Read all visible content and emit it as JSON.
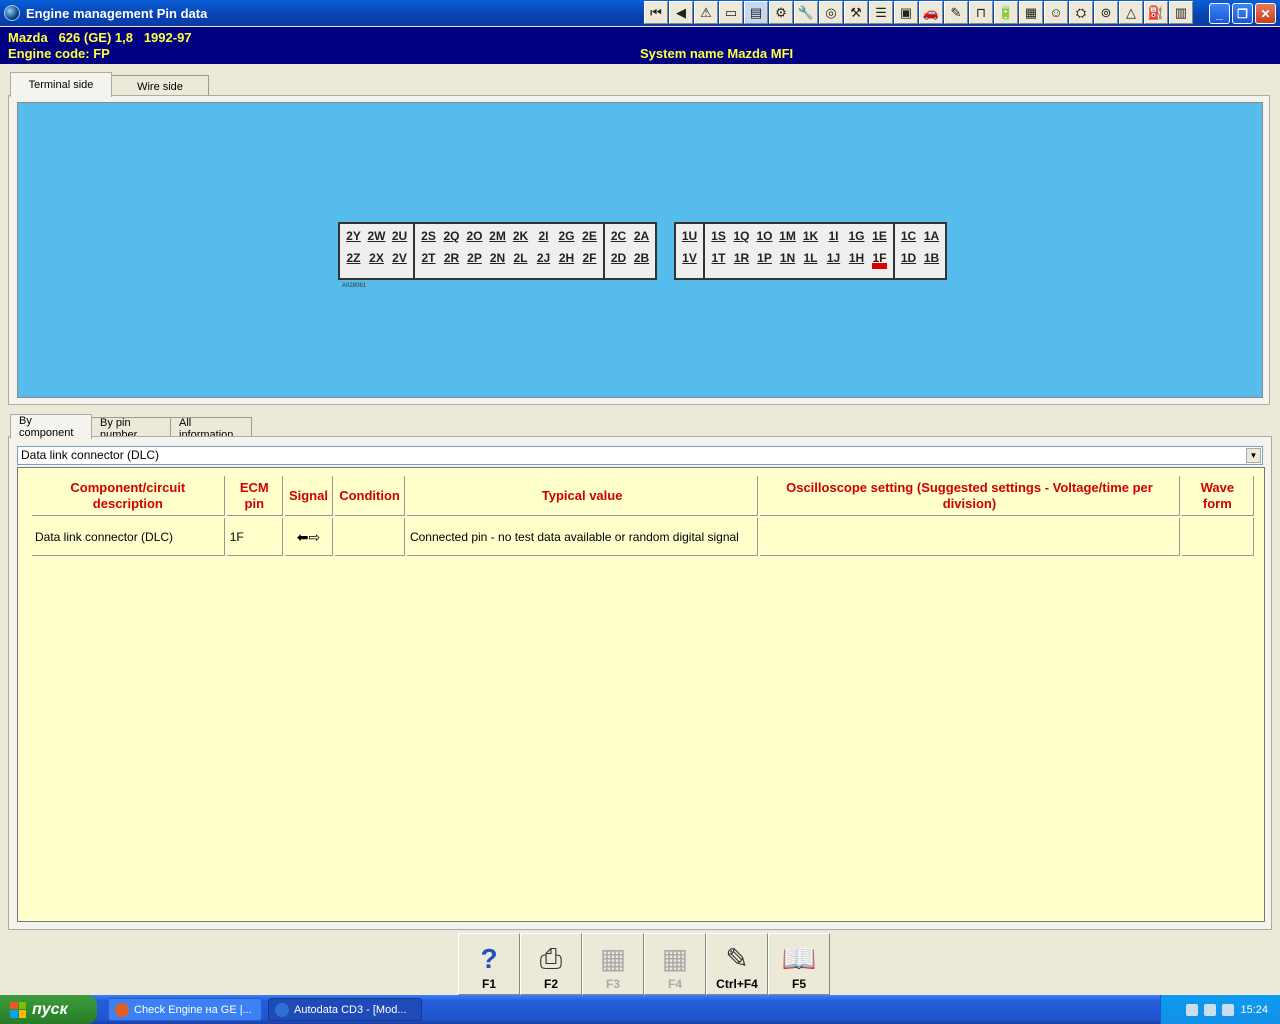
{
  "window": {
    "title": "Engine management Pin data"
  },
  "toolbar": {
    "icons": [
      "first-icon",
      "back-icon",
      "warning-icon",
      "page-icon",
      "diagram-icon",
      "gear-icon",
      "wrench-icon",
      "disc-icon",
      "tool-icon",
      "list-icon",
      "save-icon",
      "car-icon",
      "probe-icon",
      "lift-icon",
      "battery-icon",
      "calendar-icon",
      "smiley-icon",
      "service-icon",
      "tyre-icon",
      "triangle-icon",
      "engine-icon",
      "note-icon"
    ]
  },
  "info": {
    "vehicle": "Mazda   626 (GE) 1,8   1992-97",
    "engine_code": "Engine code: FP",
    "system_name": "System name Mazda MFI"
  },
  "top_tabs": [
    "Terminal side",
    "Wire side"
  ],
  "connector_left": [
    [
      [
        "2Y",
        "2Z"
      ],
      [
        "2W",
        "2X"
      ],
      [
        "2U",
        "2V"
      ]
    ],
    [
      [
        "2S",
        "2T"
      ],
      [
        "2Q",
        "2R"
      ],
      [
        "2O",
        "2P"
      ],
      [
        "2M",
        "2N"
      ],
      [
        "2K",
        "2L"
      ],
      [
        "2I",
        "2J"
      ],
      [
        "2G",
        "2H"
      ],
      [
        "2E",
        "2F"
      ]
    ],
    [
      [
        "2C",
        "2D"
      ],
      [
        "2A",
        "2B"
      ]
    ]
  ],
  "connector_right": [
    [
      [
        "1U",
        "1V"
      ]
    ],
    [
      [
        "1S",
        "1T"
      ],
      [
        "1Q",
        "1R"
      ],
      [
        "1O",
        "1P"
      ],
      [
        "1M",
        "1N"
      ],
      [
        "1K",
        "1L"
      ],
      [
        "1I",
        "1J"
      ],
      [
        "1G",
        "1H"
      ],
      [
        "1E",
        "1F"
      ]
    ],
    [
      [
        "1C",
        "1D"
      ],
      [
        "1A",
        "1B"
      ]
    ]
  ],
  "highlight_pin": "1F",
  "diagram_code": "A028061",
  "bottom_tabs": [
    "By component",
    "By pin number",
    "All information"
  ],
  "component_select": "Data link connector (DLC)",
  "table": {
    "headers": [
      "Component/circuit description",
      "ECM pin",
      "Signal",
      "Condition",
      "Typical value",
      "Oscilloscope setting (Suggested settings - Voltage/time per division)",
      "Wave form"
    ],
    "rows": [
      {
        "component": "Data link connector (DLC)",
        "pin": "1F",
        "signal": "⬅⇨",
        "condition": "",
        "typical": "Connected pin - no test data available or random digital signal",
        "scope": "",
        "wave": ""
      }
    ]
  },
  "fkeys": [
    {
      "icon": "help-icon",
      "glyph": "?",
      "label": "F1",
      "enabled": true
    },
    {
      "icon": "printer-icon",
      "glyph": "⎙",
      "label": "F2",
      "enabled": true
    },
    {
      "icon": "disabled-icon",
      "glyph": "▦",
      "label": "F3",
      "enabled": false
    },
    {
      "icon": "disabled-icon",
      "glyph": "▦",
      "label": "F4",
      "enabled": false
    },
    {
      "icon": "notes-icon",
      "glyph": "✎",
      "label": "Ctrl+F4",
      "enabled": true
    },
    {
      "icon": "book-icon",
      "glyph": "📖",
      "label": "F5",
      "enabled": true
    }
  ],
  "taskbar": {
    "start": "пуск",
    "tasks": [
      {
        "label": "Check Engine на GE |...",
        "active": false,
        "color": "#e06020"
      },
      {
        "label": "Autodata CD3 - [Mod...",
        "active": true,
        "color": "#3070d0"
      }
    ],
    "clock": "15:24"
  }
}
